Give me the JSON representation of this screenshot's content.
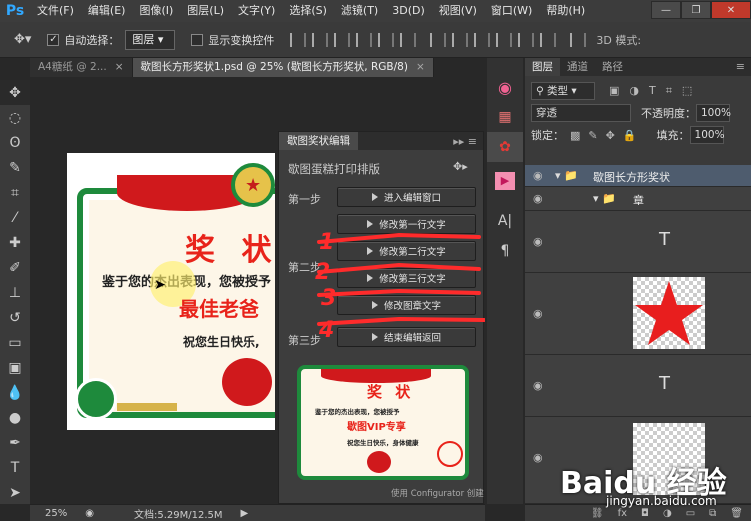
{
  "app": {
    "logo": "Ps"
  },
  "menubar": {
    "items": [
      "文件(F)",
      "编辑(E)",
      "图像(I)",
      "图层(L)",
      "文字(Y)",
      "选择(S)",
      "滤镜(T)",
      "3D(D)",
      "视图(V)",
      "窗口(W)",
      "帮助(H)"
    ]
  },
  "optionsbar": {
    "auto_select_label": "自动选择：",
    "auto_select_value": "图层",
    "show_transform_label": "显示变换控件",
    "mode_3d_label": "3D 模式:"
  },
  "doc_tabs": [
    {
      "label": "A4糖纸 @ 2...",
      "close": "×"
    },
    {
      "label": "歇图长方形奖状1.psd @ 25% (歇图长方形奖状, RGB/8)",
      "close": "×"
    }
  ],
  "statusbar": {
    "zoom": "25%",
    "doc_info": "文档:5.29M/12.5M"
  },
  "certificate": {
    "title": "奖 状",
    "line1": "鉴于您的杰出表现，您被授予",
    "line2": "最佳老爸",
    "line3": "祝您生日快乐,"
  },
  "extension": {
    "tab_label": "歇图奖状编辑",
    "header": "歇图蛋糕打印排版",
    "step1_label": "第一步",
    "step2_label": "第二步",
    "step3_label": "第三步",
    "btn_enter": "进入编辑窗口",
    "btn_line1": "修改第一行文字",
    "btn_line2": "修改第二行文字",
    "btn_line3": "修改第三行文字",
    "btn_seal": "修改图章文字",
    "btn_finish": "结束编辑返回",
    "footer": "使用 Configurator 创建",
    "annotations": [
      "1",
      "2",
      "3",
      "4"
    ],
    "preview": {
      "title": "奖 状",
      "line1": "鉴于您的杰出表现，您被授予",
      "line2": "歇图VIP专享",
      "line3": "祝您生日快乐，身体健康"
    }
  },
  "layers_panel": {
    "tabs": [
      "图层",
      "通道",
      "路径"
    ],
    "filter_label": "类型",
    "blend_mode": "穿透",
    "opacity_label": "不透明度：",
    "opacity_value": "100%",
    "lock_label": "锁定：",
    "fill_label": "填充：",
    "fill_value": "100%",
    "layers": [
      {
        "name": "歇图长方形奖状",
        "type": "group"
      },
      {
        "name": "章",
        "type": "group"
      },
      {
        "name": "",
        "type": "text"
      },
      {
        "name": "",
        "type": "star"
      },
      {
        "name": "",
        "type": "text"
      },
      {
        "name": "",
        "type": "pixel"
      }
    ],
    "bottom_icons": [
      "link-icon",
      "fx",
      "mask-icon",
      "adjustment-icon",
      "folder-icon",
      "new-layer-icon",
      "trash-icon"
    ]
  },
  "watermark": {
    "brand": "Baidu 经验",
    "url": "jingyan.baidu.com"
  },
  "colors": {
    "accent": "#31a8ff",
    "red": "#e8231a",
    "green": "#1e8a3c"
  }
}
